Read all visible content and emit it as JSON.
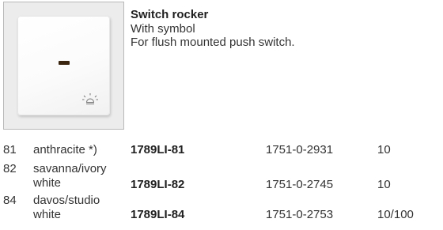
{
  "product": {
    "title": "Switch rocker",
    "subtitle": "With symbol",
    "description": "For flush mounted push switch."
  },
  "variants": [
    {
      "no": "81",
      "color_line1": "anthracite *)",
      "color_line2": "",
      "article": "1789LI-81",
      "order_no": "1751-0-2931",
      "pack": "10"
    },
    {
      "no": "82",
      "color_line1": "savanna/ivory",
      "color_line2": "white",
      "article": "1789LI-82",
      "order_no": "1751-0-2745",
      "pack": "10"
    },
    {
      "no": "84",
      "color_line1": "davos/studio",
      "color_line2": "white",
      "article": "1789LI-84",
      "order_no": "1751-0-2753",
      "pack": "10/100"
    }
  ],
  "image": {
    "item_color": "#fafafa",
    "frame_color": "#ececec",
    "symbol_icon": "light-bulb-symbol-icon"
  }
}
